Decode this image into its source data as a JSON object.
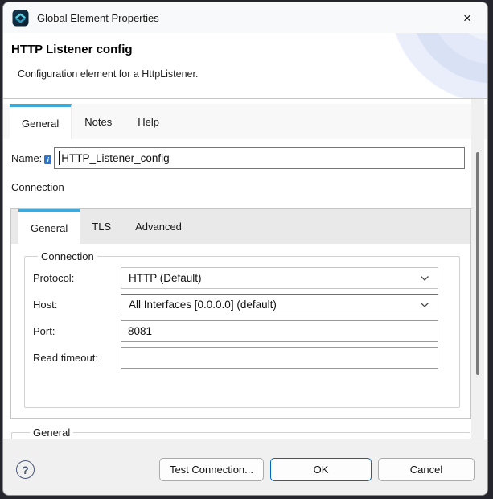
{
  "window": {
    "title": "Global Element Properties"
  },
  "icons": {
    "app": "anypoint-studio-logo",
    "close": "×",
    "help": "?",
    "info": "i",
    "chevron_down": "chevron-down"
  },
  "header": {
    "title": "HTTP Listener config",
    "description": "Configuration element for a HttpListener."
  },
  "tabs": {
    "items": [
      {
        "label": "General",
        "active": true
      },
      {
        "label": "Notes",
        "active": false
      },
      {
        "label": "Help",
        "active": false
      }
    ]
  },
  "form": {
    "name_label": "Name:",
    "name_value": "HTTP_Listener_config",
    "connection_section_label": "Connection"
  },
  "connection_panel": {
    "tabs": [
      {
        "label": "General",
        "active": true
      },
      {
        "label": "TLS",
        "active": false
      },
      {
        "label": "Advanced",
        "active": false
      }
    ],
    "group_legend": "Connection",
    "fields": [
      {
        "label": "Protocol:",
        "value": "HTTP (Default)",
        "control": "dropdown"
      },
      {
        "label": "Host:",
        "value": "All Interfaces [0.0.0.0] (default)",
        "control": "dropdown"
      },
      {
        "label": "Port:",
        "value": "8081",
        "control": "text"
      },
      {
        "label": "Read timeout:",
        "value": "",
        "control": "text"
      }
    ]
  },
  "general_group": {
    "legend": "General"
  },
  "footer": {
    "buttons": [
      {
        "label": "Test Connection...",
        "primary": false
      },
      {
        "label": "OK",
        "primary": true
      },
      {
        "label": "Cancel",
        "primary": false
      }
    ]
  },
  "colors": {
    "accent_tab_blue": "#3fa9dc",
    "ok_button_border": "#0067c0",
    "titlebar_bg": "#f8f9fb",
    "backdrop": "#24252d",
    "footer_bg": "#f0f0f1"
  }
}
